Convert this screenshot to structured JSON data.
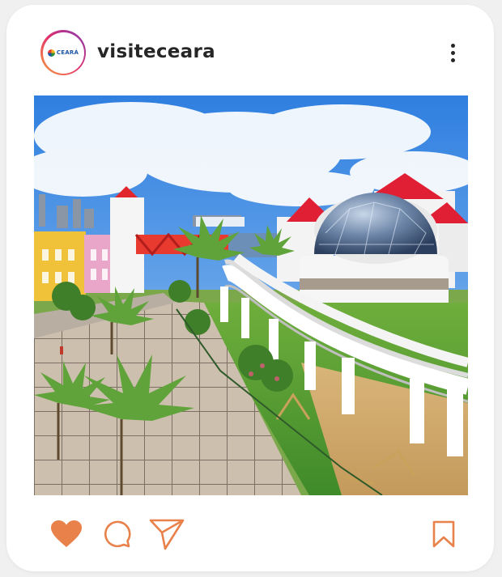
{
  "post": {
    "username": "visiteceara",
    "avatar_logo_text": "CEARÁ",
    "photo_description_icon": "photo-image",
    "liked": true
  },
  "icons": {
    "more": "more-vertical-icon",
    "like": "heart-icon",
    "comment": "comment-icon",
    "share": "send-icon",
    "save": "bookmark-icon"
  },
  "colors": {
    "accent": "#e8814a",
    "text": "#262626",
    "card": "#ffffff"
  }
}
